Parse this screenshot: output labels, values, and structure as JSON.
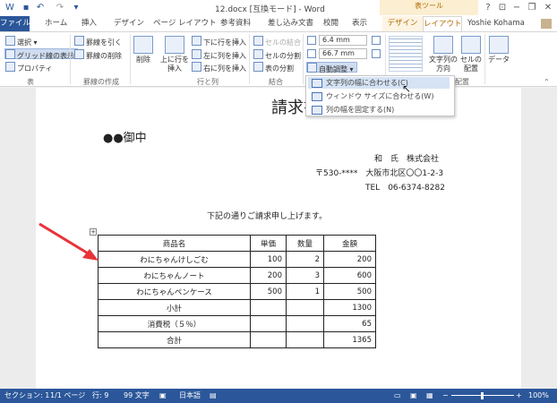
{
  "title_bar": {
    "document_title": "12.docx [互換モード] - Word",
    "context_tab_group": "表ツール",
    "help": "?",
    "minimize": "−",
    "restore": "❐",
    "close": "✕"
  },
  "tabs": [
    "ファイル",
    "ホーム",
    "挿入",
    "デザイン",
    "ページ レイアウト",
    "参考資料",
    "差し込み文書",
    "校閲",
    "表示",
    "デザイン",
    "レイアウト"
  ],
  "active_tab": "レイアウト",
  "user": "Yoshie Kohama",
  "ribbon": {
    "table": {
      "label": "表",
      "select": "選択 ▾",
      "gridlines": "グリッド線の表示",
      "properties": "プロパティ"
    },
    "draw": {
      "label": "罫線の作成",
      "draw_table": "罫線を引く",
      "eraser": "罫線の削除"
    },
    "rows_cols": {
      "label": "行と列",
      "delete": "削除",
      "insert_above": "上に行を挿入",
      "insert_below": "下に行を挿入",
      "insert_left": "左に列を挿入",
      "insert_right": "右に列を挿入"
    },
    "merge": {
      "label": "結合",
      "merge_cells": "セルの結合",
      "split_cells": "セルの分割",
      "split_table": "表の分割"
    },
    "cell_size": {
      "height": "6.4 mm",
      "width": "66.7 mm",
      "autofit": "自動調整 ▾"
    },
    "alignment": {
      "label": "配置",
      "text_direction": "文字列の方向",
      "cell_margins": "セルの配置"
    },
    "data": {
      "label": "データ"
    }
  },
  "autofit_menu": [
    "文字列の幅に合わせる(C)",
    "ウィンドウ サイズに合わせる(W)",
    "列の幅を固定する(N)"
  ],
  "document": {
    "heading": "請求書",
    "addressee": "●●御中",
    "company": "和　氏　株式会社",
    "address": "〒530-****　大阪市北区〇〇1-2-3",
    "tel": "TEL　06-6374-8282",
    "intro": "下記の通りご請求申し上げます。",
    "table": {
      "headers": [
        "商品名",
        "単価",
        "数量",
        "金額"
      ],
      "rows": [
        [
          "わにちゃんけしごむ",
          "100",
          "2",
          "200"
        ],
        [
          "わにちゃんノート",
          "200",
          "3",
          "600"
        ],
        [
          "わにちゃんペンケース",
          "500",
          "1",
          "500"
        ],
        [
          "小計",
          "",
          "",
          "1300"
        ],
        [
          "消費税（５％）",
          "",
          "",
          "65"
        ],
        [
          "合計",
          "",
          "",
          "1365"
        ]
      ]
    }
  },
  "status_bar": {
    "section": "セクション: 1",
    "page": "1/1 ページ",
    "line": "行: 9",
    "words": "99 文字",
    "language": "日本語",
    "zoom": "100%"
  },
  "colors": {
    "accent": "#2b579a",
    "context": "#b26b00",
    "arrow": "#e8333a"
  }
}
